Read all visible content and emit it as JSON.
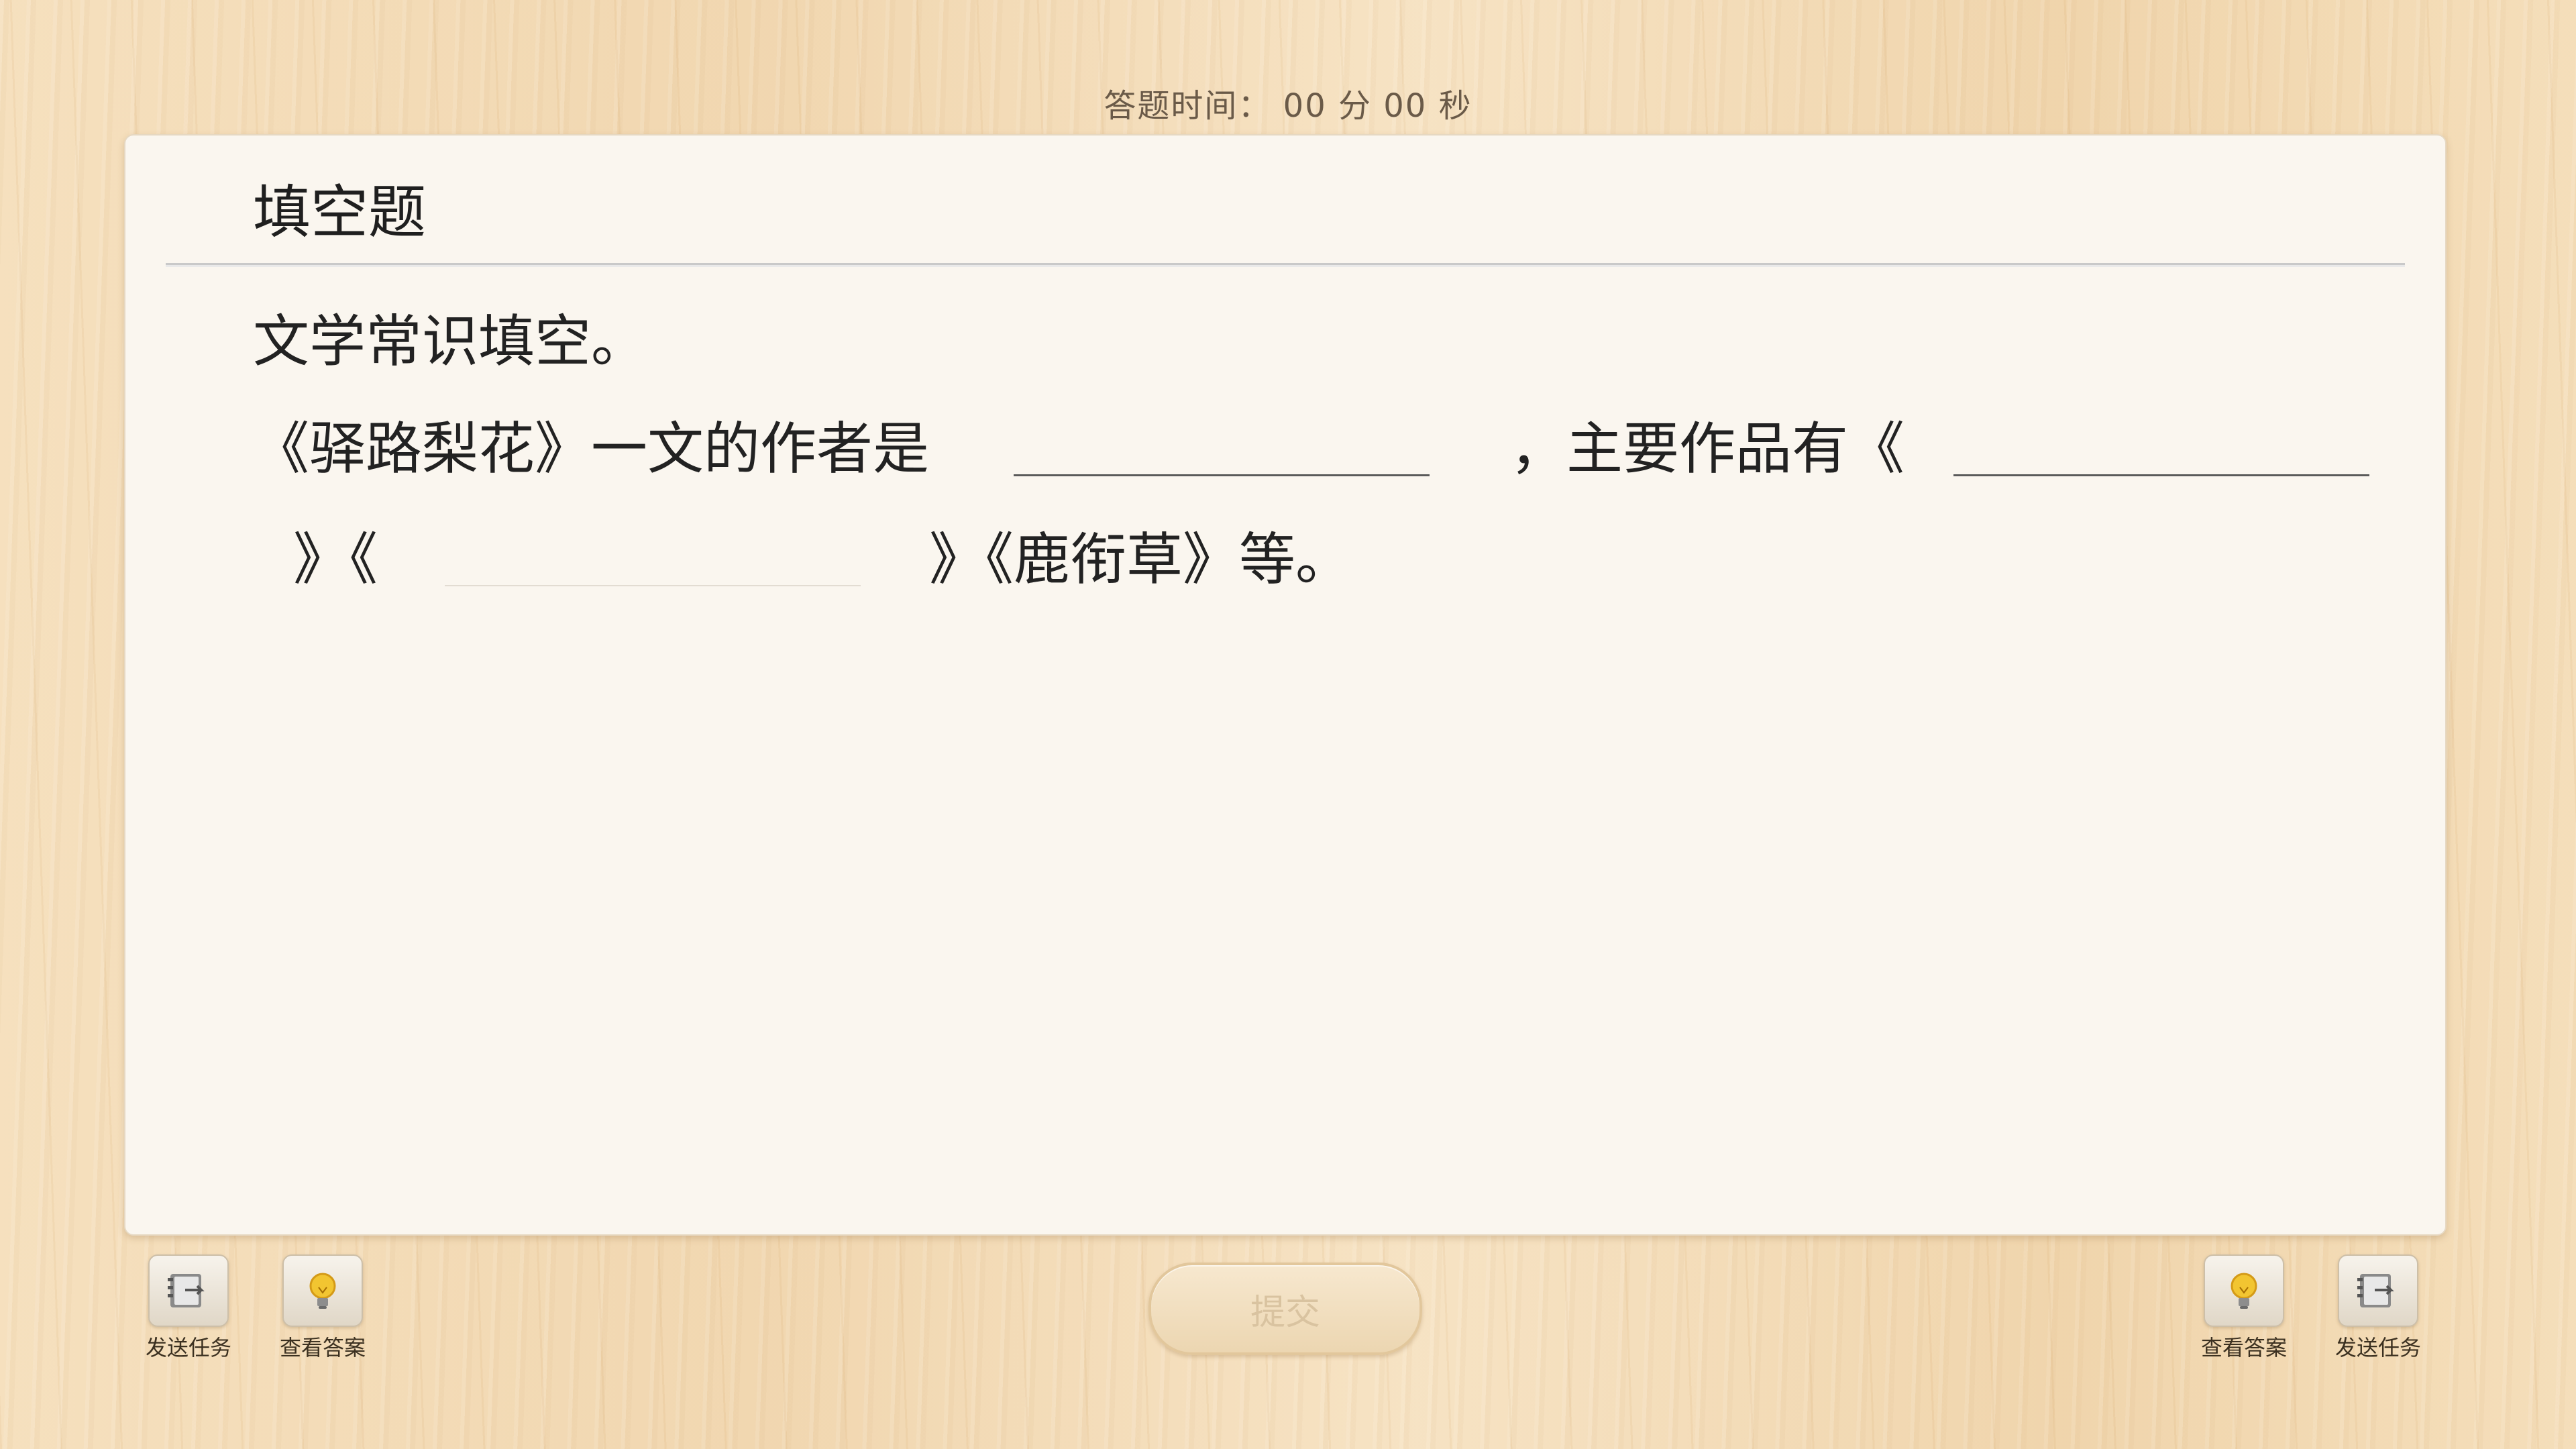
{
  "timer": {
    "text": "答题时间： 00 分 00 秒"
  },
  "question": {
    "type_title": "填空题",
    "instruction": "文学常识填空。",
    "line1_a": "《驿路梨花》一文的作者是",
    "line1_b": "，主要作品有《",
    "line2_a": "》《",
    "line2_b": "》《鹿衔草》等。"
  },
  "toolbar": {
    "left_send_task": "发送任务",
    "left_view_answer": "查看答案",
    "submit": "提交",
    "right_view_answer": "查看答案",
    "right_send_task": "发送任务"
  },
  "icons": {
    "send_task": "notebook-send-icon",
    "view_answer": "lightbulb-icon"
  },
  "colors": {
    "background": "#f3dcb8",
    "card": "#faf6ef",
    "submit_text": "#d9c3a0"
  }
}
